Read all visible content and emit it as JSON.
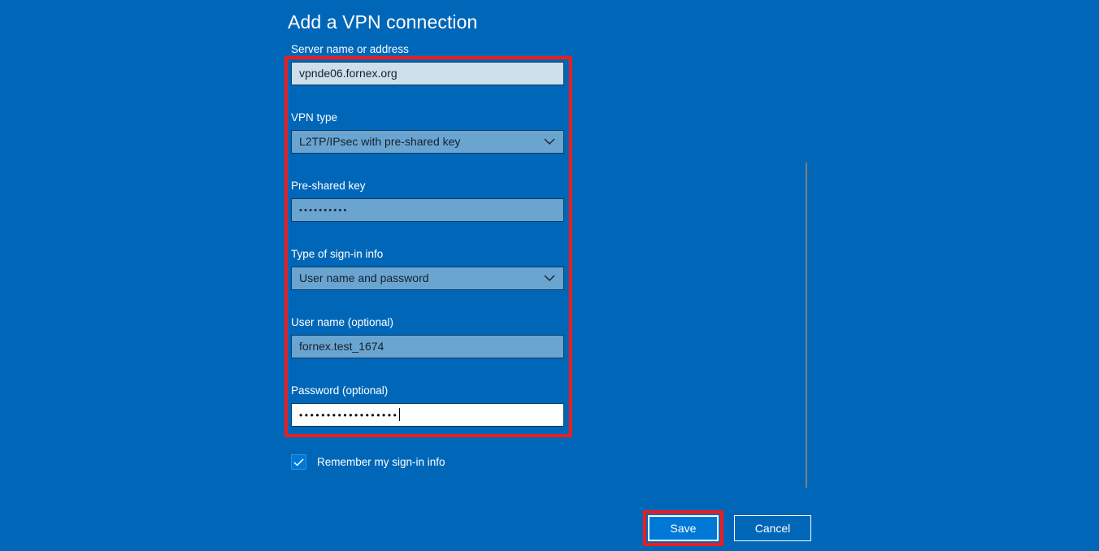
{
  "dialog": {
    "title": "Add a VPN connection",
    "background_color": "#0067b8"
  },
  "fields": [
    {
      "label": "Server name or address",
      "value": "vpnde06.fornex.org",
      "type": "text",
      "state": "hover"
    },
    {
      "label": "VPN type",
      "value": "L2TP/IPsec with pre-shared key",
      "type": "combobox",
      "state": "normal"
    },
    {
      "label": "Pre-shared key",
      "value": "••••••••••",
      "type": "password",
      "state": "normal"
    },
    {
      "label": "Type of sign-in info",
      "value": "User name and password",
      "type": "combobox",
      "state": "normal"
    },
    {
      "label": "User name (optional)",
      "value": "fornex.test_1674",
      "type": "text",
      "state": "normal"
    },
    {
      "label": "Password (optional)",
      "value": "••••••••••••••••••",
      "type": "password",
      "state": "focused"
    }
  ],
  "checkbox": {
    "label": "Remember my sign-in info",
    "checked": true,
    "accent_color": "#0078d7"
  },
  "buttons": {
    "save_label": "Save",
    "cancel_label": "Cancel",
    "save_color": "#0078d7"
  },
  "annotations": {
    "color": "#ee1c1c",
    "fields_box": "form fields highlight",
    "save_box": "save button highlight"
  }
}
